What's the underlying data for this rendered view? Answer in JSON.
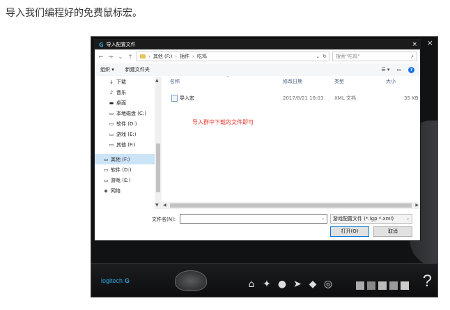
{
  "caption": "导入我们编程好的免费鼠标宏。",
  "app": {
    "close": "×",
    "brand": "logitech",
    "brand_mark": "G",
    "help": "?"
  },
  "dialog": {
    "title": "导入配置文件",
    "close": "×",
    "breadcrumb": [
      "其他 (F:)",
      "插件",
      "吃鸡"
    ],
    "search_placeholder": "搜索\"吃鸡\"",
    "organize": "组织 ▾",
    "new_folder": "新建文件夹",
    "nav_items": [
      {
        "icon": "download-icon",
        "glyph": "↓",
        "label": "下载",
        "indent": 1
      },
      {
        "icon": "music-icon",
        "glyph": "♪",
        "label": "音乐",
        "indent": 1
      },
      {
        "icon": "desktop-icon",
        "glyph": "▬",
        "label": "桌面",
        "indent": 1
      },
      {
        "icon": "local-disk-icon",
        "glyph": "▭",
        "label": "本地磁盘 (C:)",
        "indent": 1
      },
      {
        "icon": "drive-icon",
        "glyph": "▭",
        "label": "软件 (D:)",
        "indent": 1
      },
      {
        "icon": "drive-icon",
        "glyph": "▭",
        "label": "游戏 (E:)",
        "indent": 1
      },
      {
        "icon": "drive-icon",
        "glyph": "▭",
        "label": "其他 (F:)",
        "indent": 1
      },
      {
        "icon": "drive-icon",
        "glyph": "▭",
        "label": "其他 (F:)",
        "indent": 0,
        "selected": true
      },
      {
        "icon": "drive-icon",
        "glyph": "▭",
        "label": "软件 (D:)",
        "indent": 0
      },
      {
        "icon": "drive-icon",
        "glyph": "▭",
        "label": "游戏 (E:)",
        "indent": 0
      },
      {
        "icon": "network-icon",
        "glyph": "◈",
        "label": "网络",
        "indent": 0
      }
    ],
    "columns": [
      "名称",
      "修改日期",
      "类型",
      "大小"
    ],
    "files": [
      {
        "name": "导入宏",
        "modified": "2017/8/21 18:03",
        "type": "XML 文档",
        "size": "35 KB"
      }
    ],
    "annotation": "导入群中下载的文件即可",
    "filename_label": "文件名(N):",
    "filename_value": "",
    "filetype": "游戏配置文件 (*.lgp *.xml)",
    "open_button": "打开(O)",
    "cancel_button": "取消"
  },
  "colors": {
    "accent": "#2fa8e0",
    "annotation": "#e3352b",
    "selection": "#cce4f7"
  }
}
